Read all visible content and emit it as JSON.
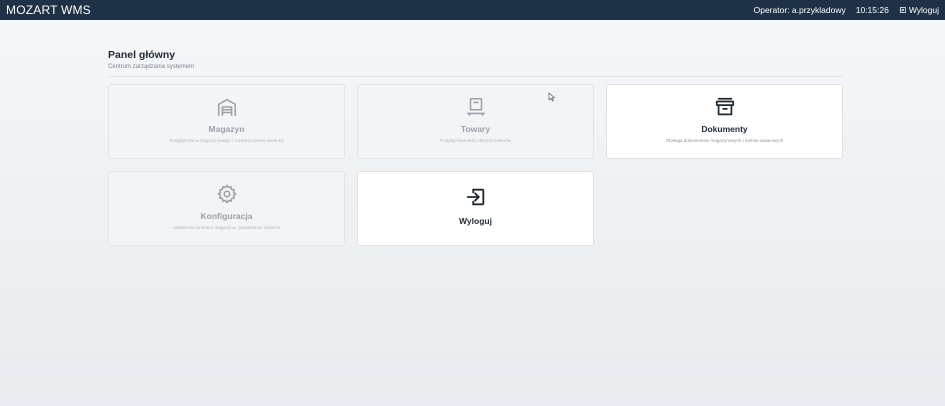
{
  "header": {
    "brand": "MOZART WMS",
    "operator": "Operator: a.przykladowy",
    "time": "10:15:26",
    "logout_label": "Wyloguj"
  },
  "page": {
    "title": "Panel główny",
    "subtitle": "Centrum zarządzania systemem"
  },
  "tiles": [
    {
      "title": "Magazyn",
      "description": "Podgląd stanu magazynowego i rozmieszczenia towarów",
      "icon": "warehouse-icon",
      "state": "disabled"
    },
    {
      "title": "Towary",
      "description": "Podgląd kartoteki i danych towarów",
      "icon": "product-icon",
      "state": "disabled"
    },
    {
      "title": "Dokumenty",
      "description": "Obsługa dokumentów magazynowych i kartów towarowych",
      "icon": "archive-icon",
      "state": "enabled"
    },
    {
      "title": "Konfiguracja",
      "description": "Ustawienia struktury magazynu i parametrów systemu",
      "icon": "gear-icon",
      "state": "disabled"
    },
    {
      "title": "Wyloguj",
      "icon": "logout-icon",
      "state": "enabled"
    }
  ],
  "colors": {
    "topbar": "#1f3147",
    "icon_active": "#1f2933",
    "icon_disabled": "#9aa2ab"
  }
}
